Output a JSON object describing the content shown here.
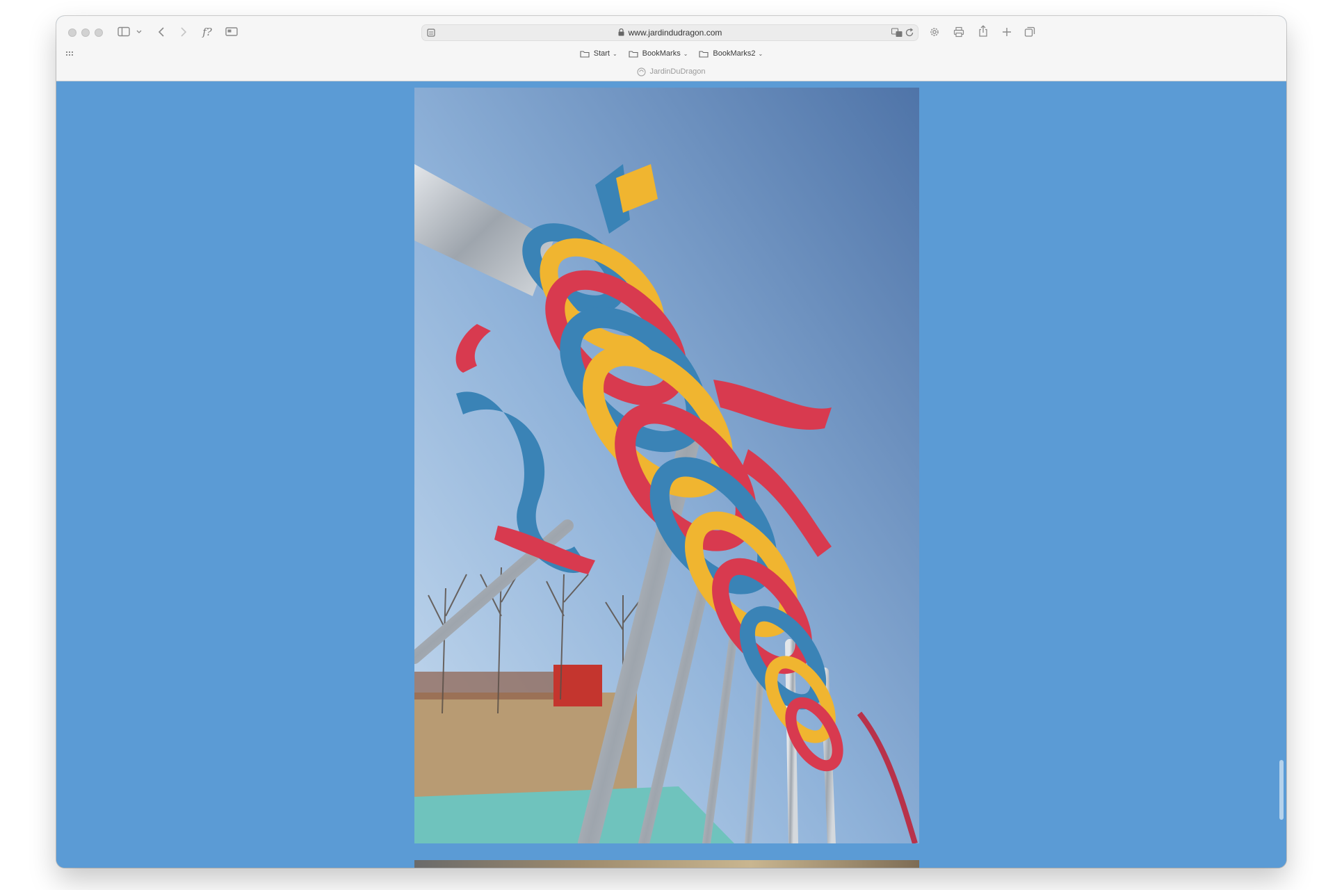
{
  "browser": {
    "url": "www.jardindudragon.com",
    "tab_title": "JardinDuDragon",
    "bookmarks": [
      {
        "label": "Start"
      },
      {
        "label": "BookMarks"
      },
      {
        "label": "BookMarks2"
      }
    ]
  },
  "page": {
    "background_color": "#5b9bd5"
  },
  "icons": {
    "sidebar": "sidebar-icon",
    "back": "chevron-left-icon",
    "forward": "chevron-right-icon",
    "formula": "formula-icon",
    "screen": "screen-icon",
    "translate": "translate-icon",
    "reload": "reload-icon",
    "settings": "gear-icon",
    "print": "print-icon",
    "share": "share-icon",
    "new_tab": "plus-icon",
    "tabs": "tabs-overview-icon"
  },
  "toolbar": {
    "formula_label": "f?"
  }
}
